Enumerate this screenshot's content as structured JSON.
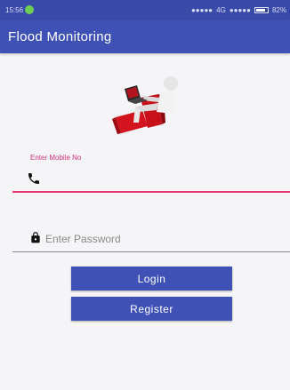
{
  "status_bar": {
    "time": "15:56",
    "network_text": "4G",
    "battery_percent": "82%",
    "battery_level": 0.82
  },
  "app_bar": {
    "title": "Flood Monitoring"
  },
  "login_form": {
    "mobile_label": "Enter Mobile No",
    "mobile_value": "",
    "password_placeholder": "Enter Password",
    "login_label": "Login",
    "register_label": "Register"
  },
  "icons": {
    "illustration": "person-at-laptop-illustration",
    "mobile": "phone-icon",
    "password": "lock-icon"
  },
  "colors": {
    "primary": "#3f51b5",
    "status_bar": "#3a4aa8",
    "accent": "#e63b6c",
    "label": "#d1347f"
  }
}
